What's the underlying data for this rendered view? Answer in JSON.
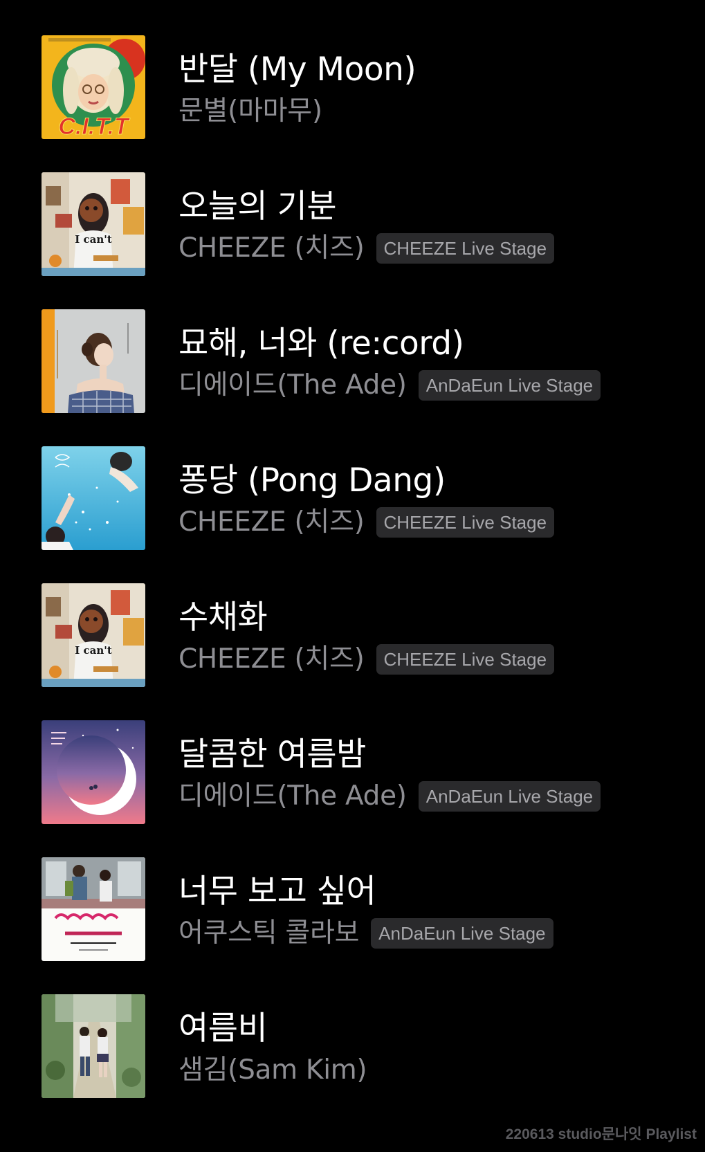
{
  "tracks": [
    {
      "title": "반달 (My Moon)",
      "artist": "문별(마마무)",
      "tag": "",
      "art": "citt-cover-art"
    },
    {
      "title": "오늘의 기분",
      "artist": "CHEEZE (치즈)",
      "tag": "CHEEZE Live Stage",
      "art": "cheeze-room-cover-art"
    },
    {
      "title": "묘해, 너와 (re:cord)",
      "artist": "디에이드(The Ade)",
      "tag": "AnDaEun Live Stage",
      "art": "the-ade-portrait-cover-art"
    },
    {
      "title": "퐁당 (Pong Dang)",
      "artist": "CHEEZE (치즈)",
      "tag": "CHEEZE Live Stage",
      "art": "pong-dang-underwater-cover-art"
    },
    {
      "title": "수채화",
      "artist": "CHEEZE (치즈)",
      "tag": "CHEEZE Live Stage",
      "art": "cheeze-room-cover-art"
    },
    {
      "title": "달콤한 여름밤",
      "artist": "디에이드(The Ade)",
      "tag": "AnDaEun Live Stage",
      "art": "crescent-moon-cover-art"
    },
    {
      "title": "너무 보고 싶어",
      "artist": "어쿠스틱 콜라보",
      "tag": "AnDaEun Live Stage",
      "art": "ost-subway-cover-art"
    },
    {
      "title": "여름비",
      "artist": "샘김(Sam Kim)",
      "tag": "",
      "art": "alley-couple-cover-art"
    }
  ],
  "art_text": {
    "citt": "C.I.T.T",
    "icant": "I can't"
  },
  "footer": {
    "caption": "220613 studio문나잇 Playlist"
  },
  "colors": {
    "background": "#000000",
    "title": "#ffffff",
    "artist": "#8e8e93",
    "tag_bg": "#2a2a2c",
    "tag_text": "#a7a7ab"
  }
}
